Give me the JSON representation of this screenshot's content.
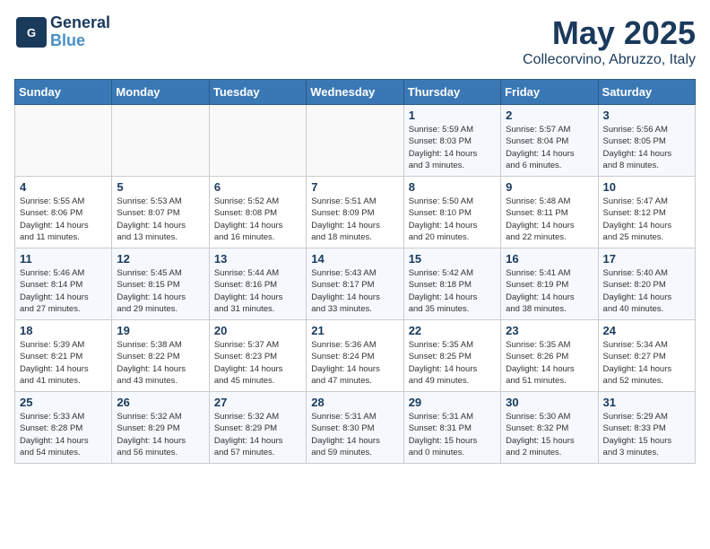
{
  "logo": {
    "line1": "General",
    "line2": "Blue"
  },
  "title": "May 2025",
  "location": "Collecorvino, Abruzzo, Italy",
  "days_header": [
    "Sunday",
    "Monday",
    "Tuesday",
    "Wednesday",
    "Thursday",
    "Friday",
    "Saturday"
  ],
  "weeks": [
    [
      {
        "day": "",
        "info": ""
      },
      {
        "day": "",
        "info": ""
      },
      {
        "day": "",
        "info": ""
      },
      {
        "day": "",
        "info": ""
      },
      {
        "day": "1",
        "info": "Sunrise: 5:59 AM\nSunset: 8:03 PM\nDaylight: 14 hours\nand 3 minutes."
      },
      {
        "day": "2",
        "info": "Sunrise: 5:57 AM\nSunset: 8:04 PM\nDaylight: 14 hours\nand 6 minutes."
      },
      {
        "day": "3",
        "info": "Sunrise: 5:56 AM\nSunset: 8:05 PM\nDaylight: 14 hours\nand 8 minutes."
      }
    ],
    [
      {
        "day": "4",
        "info": "Sunrise: 5:55 AM\nSunset: 8:06 PM\nDaylight: 14 hours\nand 11 minutes."
      },
      {
        "day": "5",
        "info": "Sunrise: 5:53 AM\nSunset: 8:07 PM\nDaylight: 14 hours\nand 13 minutes."
      },
      {
        "day": "6",
        "info": "Sunrise: 5:52 AM\nSunset: 8:08 PM\nDaylight: 14 hours\nand 16 minutes."
      },
      {
        "day": "7",
        "info": "Sunrise: 5:51 AM\nSunset: 8:09 PM\nDaylight: 14 hours\nand 18 minutes."
      },
      {
        "day": "8",
        "info": "Sunrise: 5:50 AM\nSunset: 8:10 PM\nDaylight: 14 hours\nand 20 minutes."
      },
      {
        "day": "9",
        "info": "Sunrise: 5:48 AM\nSunset: 8:11 PM\nDaylight: 14 hours\nand 22 minutes."
      },
      {
        "day": "10",
        "info": "Sunrise: 5:47 AM\nSunset: 8:12 PM\nDaylight: 14 hours\nand 25 minutes."
      }
    ],
    [
      {
        "day": "11",
        "info": "Sunrise: 5:46 AM\nSunset: 8:14 PM\nDaylight: 14 hours\nand 27 minutes."
      },
      {
        "day": "12",
        "info": "Sunrise: 5:45 AM\nSunset: 8:15 PM\nDaylight: 14 hours\nand 29 minutes."
      },
      {
        "day": "13",
        "info": "Sunrise: 5:44 AM\nSunset: 8:16 PM\nDaylight: 14 hours\nand 31 minutes."
      },
      {
        "day": "14",
        "info": "Sunrise: 5:43 AM\nSunset: 8:17 PM\nDaylight: 14 hours\nand 33 minutes."
      },
      {
        "day": "15",
        "info": "Sunrise: 5:42 AM\nSunset: 8:18 PM\nDaylight: 14 hours\nand 35 minutes."
      },
      {
        "day": "16",
        "info": "Sunrise: 5:41 AM\nSunset: 8:19 PM\nDaylight: 14 hours\nand 38 minutes."
      },
      {
        "day": "17",
        "info": "Sunrise: 5:40 AM\nSunset: 8:20 PM\nDaylight: 14 hours\nand 40 minutes."
      }
    ],
    [
      {
        "day": "18",
        "info": "Sunrise: 5:39 AM\nSunset: 8:21 PM\nDaylight: 14 hours\nand 41 minutes."
      },
      {
        "day": "19",
        "info": "Sunrise: 5:38 AM\nSunset: 8:22 PM\nDaylight: 14 hours\nand 43 minutes."
      },
      {
        "day": "20",
        "info": "Sunrise: 5:37 AM\nSunset: 8:23 PM\nDaylight: 14 hours\nand 45 minutes."
      },
      {
        "day": "21",
        "info": "Sunrise: 5:36 AM\nSunset: 8:24 PM\nDaylight: 14 hours\nand 47 minutes."
      },
      {
        "day": "22",
        "info": "Sunrise: 5:35 AM\nSunset: 8:25 PM\nDaylight: 14 hours\nand 49 minutes."
      },
      {
        "day": "23",
        "info": "Sunrise: 5:35 AM\nSunset: 8:26 PM\nDaylight: 14 hours\nand 51 minutes."
      },
      {
        "day": "24",
        "info": "Sunrise: 5:34 AM\nSunset: 8:27 PM\nDaylight: 14 hours\nand 52 minutes."
      }
    ],
    [
      {
        "day": "25",
        "info": "Sunrise: 5:33 AM\nSunset: 8:28 PM\nDaylight: 14 hours\nand 54 minutes."
      },
      {
        "day": "26",
        "info": "Sunrise: 5:32 AM\nSunset: 8:29 PM\nDaylight: 14 hours\nand 56 minutes."
      },
      {
        "day": "27",
        "info": "Sunrise: 5:32 AM\nSunset: 8:29 PM\nDaylight: 14 hours\nand 57 minutes."
      },
      {
        "day": "28",
        "info": "Sunrise: 5:31 AM\nSunset: 8:30 PM\nDaylight: 14 hours\nand 59 minutes."
      },
      {
        "day": "29",
        "info": "Sunrise: 5:31 AM\nSunset: 8:31 PM\nDaylight: 15 hours\nand 0 minutes."
      },
      {
        "day": "30",
        "info": "Sunrise: 5:30 AM\nSunset: 8:32 PM\nDaylight: 15 hours\nand 2 minutes."
      },
      {
        "day": "31",
        "info": "Sunrise: 5:29 AM\nSunset: 8:33 PM\nDaylight: 15 hours\nand 3 minutes."
      }
    ]
  ]
}
